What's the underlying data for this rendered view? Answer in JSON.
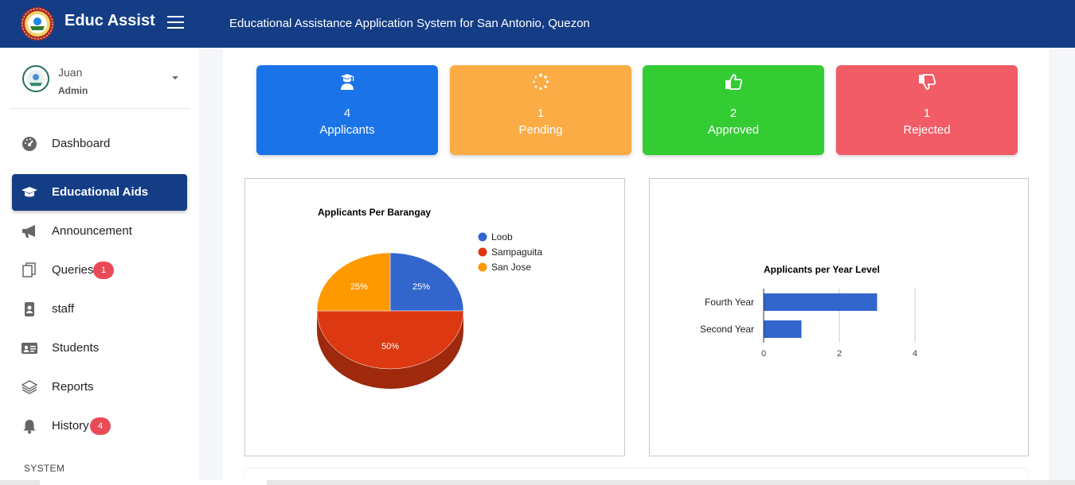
{
  "header": {
    "brand": "Educ Assist",
    "system_title": "Educational Assistance Application System for San Antonio, Quezon",
    "color": "#143d86"
  },
  "user": {
    "name": "Juan",
    "role": "Admin"
  },
  "sidebar": {
    "items": [
      {
        "label": "Dashboard",
        "icon": "dashboard-icon"
      },
      {
        "label": "Educational Aids",
        "icon": "graduation-cap-icon",
        "active": true
      },
      {
        "label": "Announcement",
        "icon": "megaphone-icon"
      },
      {
        "label": "Queries",
        "icon": "copy-icon",
        "badge": "1"
      },
      {
        "label": "staff",
        "icon": "id-badge-icon"
      },
      {
        "label": "Students",
        "icon": "id-card-icon"
      },
      {
        "label": "Reports",
        "icon": "layers-icon"
      },
      {
        "label": "History",
        "icon": "bell-icon",
        "badge": "4"
      }
    ],
    "section_header": "SYSTEM"
  },
  "stats": [
    {
      "value": "4",
      "label": "Applicants",
      "color": "#1a74e8",
      "icon": "user-graduate-icon"
    },
    {
      "value": "1",
      "label": "Pending",
      "color": "#fbac45",
      "icon": "spinner-icon"
    },
    {
      "value": "2",
      "label": "Approved",
      "color": "#33cc33",
      "icon": "thumbs-up-icon"
    },
    {
      "value": "1",
      "label": "Rejected",
      "color": "#f15c66",
      "icon": "thumbs-down-icon"
    }
  ],
  "chart_data": [
    {
      "type": "pie",
      "title": "Applicants Per Barangay",
      "is3D": true,
      "slices": [
        {
          "label": "Loob",
          "value": 1,
          "percent": "25%",
          "color": "#3366cc"
        },
        {
          "label": "Sampaguita",
          "value": 2,
          "percent": "50%",
          "color": "#dc3912"
        },
        {
          "label": "San Jose",
          "value": 1,
          "percent": "25%",
          "color": "#ff9900"
        }
      ],
      "legend": "right"
    },
    {
      "type": "bar",
      "orientation": "horizontal",
      "title": "Applicants per Year Level",
      "categories": [
        "Fourth Year",
        "Second Year"
      ],
      "values": [
        3,
        1
      ],
      "color": "#3366cc",
      "xlim": [
        0,
        4
      ],
      "xticks": [
        "0",
        "2",
        "4"
      ],
      "grid": true
    }
  ]
}
